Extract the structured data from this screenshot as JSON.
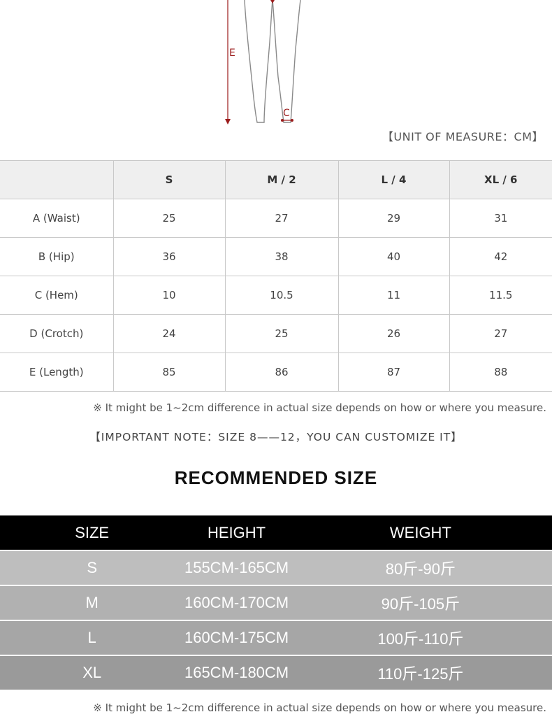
{
  "diagram": {
    "label_e": "E",
    "label_c": "C",
    "arrow_color": "#9b1c1c"
  },
  "unit_label": "【UNIT OF MEASURE：CM】",
  "size_table": {
    "headers": [
      "",
      "S",
      "M / 2",
      "L / 4",
      "XL / 6"
    ],
    "rows": [
      {
        "label": "A (Waist)",
        "values": [
          "25",
          "27",
          "29",
          "31"
        ]
      },
      {
        "label": "B (Hip)",
        "values": [
          "36",
          "38",
          "40",
          "42"
        ]
      },
      {
        "label": "C (Hem)",
        "values": [
          "10",
          "10.5",
          "11",
          "11.5"
        ]
      },
      {
        "label": "D (Crotch)",
        "values": [
          "24",
          "25",
          "26",
          "27"
        ]
      },
      {
        "label": "E (Length)",
        "values": [
          "85",
          "86",
          "87",
          "88"
        ]
      }
    ]
  },
  "note_difference": "※ It might be 1~2cm difference in actual size depends on how or where you measure.",
  "note_important": "【IMPORTANT NOTE：SIZE 8——12，YOU CAN CUSTOMIZE IT】",
  "recommended": {
    "title": "RECOMMENDED SIZE",
    "headers": [
      "SIZE",
      "HEIGHT",
      "WEIGHT"
    ],
    "rows": [
      {
        "size": "S",
        "height": "155CM-165CM",
        "weight": "80斤-90斤"
      },
      {
        "size": "M",
        "height": "160CM-170CM",
        "weight": "90斤-105斤"
      },
      {
        "size": "L",
        "height": "160CM-175CM",
        "weight": "100斤-110斤"
      },
      {
        "size": "XL",
        "height": "165CM-180CM",
        "weight": "110斤-125斤"
      }
    ]
  },
  "note_bottom": "※ It might be 1~2cm difference in actual size depends on how or where you measure."
}
